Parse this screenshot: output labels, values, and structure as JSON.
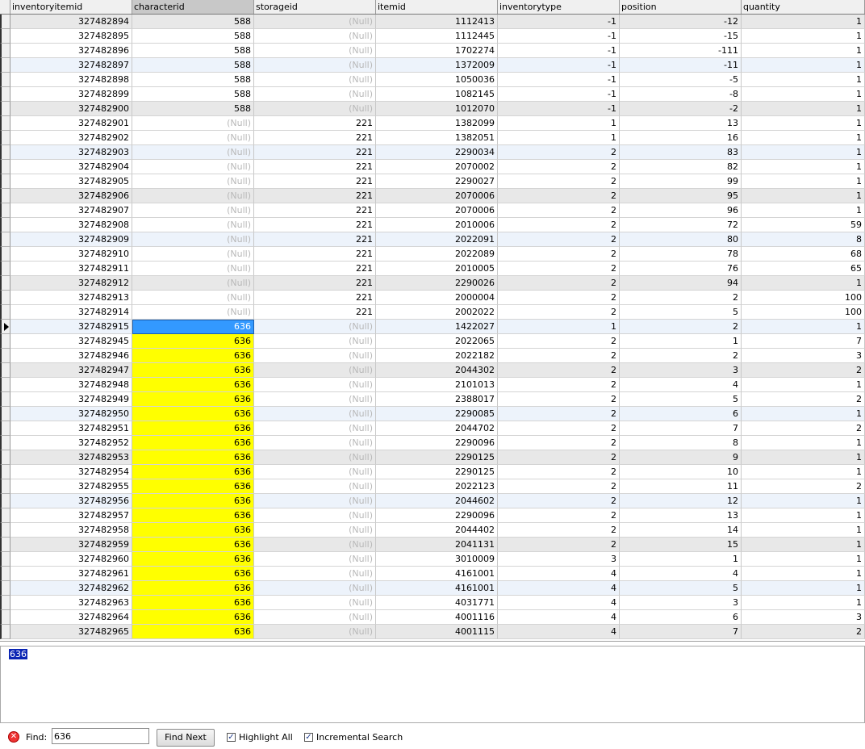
{
  "columns": [
    "inventoryitemid",
    "characterid",
    "storageid",
    "itemid",
    "inventorytype",
    "position",
    "quantity"
  ],
  "selected_column_index": 1,
  "null_text": "(Null)",
  "rows": [
    [
      "327482894",
      "588",
      null,
      "1112413",
      "-1",
      "-12",
      "1"
    ],
    [
      "327482895",
      "588",
      null,
      "1112445",
      "-1",
      "-15",
      "1"
    ],
    [
      "327482896",
      "588",
      null,
      "1702274",
      "-1",
      "-111",
      "1"
    ],
    [
      "327482897",
      "588",
      null,
      "1372009",
      "-1",
      "-11",
      "1"
    ],
    [
      "327482898",
      "588",
      null,
      "1050036",
      "-1",
      "-5",
      "1"
    ],
    [
      "327482899",
      "588",
      null,
      "1082145",
      "-1",
      "-8",
      "1"
    ],
    [
      "327482900",
      "588",
      null,
      "1012070",
      "-1",
      "-2",
      "1"
    ],
    [
      "327482901",
      null,
      "221",
      "1382099",
      "1",
      "13",
      "1"
    ],
    [
      "327482902",
      null,
      "221",
      "1382051",
      "1",
      "16",
      "1"
    ],
    [
      "327482903",
      null,
      "221",
      "2290034",
      "2",
      "83",
      "1"
    ],
    [
      "327482904",
      null,
      "221",
      "2070002",
      "2",
      "82",
      "1"
    ],
    [
      "327482905",
      null,
      "221",
      "2290027",
      "2",
      "99",
      "1"
    ],
    [
      "327482906",
      null,
      "221",
      "2070006",
      "2",
      "95",
      "1"
    ],
    [
      "327482907",
      null,
      "221",
      "2070006",
      "2",
      "96",
      "1"
    ],
    [
      "327482908",
      null,
      "221",
      "2010006",
      "2",
      "72",
      "59"
    ],
    [
      "327482909",
      null,
      "221",
      "2022091",
      "2",
      "80",
      "8"
    ],
    [
      "327482910",
      null,
      "221",
      "2022089",
      "2",
      "78",
      "68"
    ],
    [
      "327482911",
      null,
      "221",
      "2010005",
      "2",
      "76",
      "65"
    ],
    [
      "327482912",
      null,
      "221",
      "2290026",
      "2",
      "94",
      "1"
    ],
    [
      "327482913",
      null,
      "221",
      "2000004",
      "2",
      "2",
      "100"
    ],
    [
      "327482914",
      null,
      "221",
      "2002022",
      "2",
      "5",
      "100"
    ],
    [
      "327482915",
      "636",
      null,
      "1422027",
      "1",
      "2",
      "1"
    ],
    [
      "327482945",
      "636",
      null,
      "2022065",
      "2",
      "1",
      "7"
    ],
    [
      "327482946",
      "636",
      null,
      "2022182",
      "2",
      "2",
      "3"
    ],
    [
      "327482947",
      "636",
      null,
      "2044302",
      "2",
      "3",
      "2"
    ],
    [
      "327482948",
      "636",
      null,
      "2101013",
      "2",
      "4",
      "1"
    ],
    [
      "327482949",
      "636",
      null,
      "2388017",
      "2",
      "5",
      "2"
    ],
    [
      "327482950",
      "636",
      null,
      "2290085",
      "2",
      "6",
      "1"
    ],
    [
      "327482951",
      "636",
      null,
      "2044702",
      "2",
      "7",
      "2"
    ],
    [
      "327482952",
      "636",
      null,
      "2290096",
      "2",
      "8",
      "1"
    ],
    [
      "327482953",
      "636",
      null,
      "2290125",
      "2",
      "9",
      "1"
    ],
    [
      "327482954",
      "636",
      null,
      "2290125",
      "2",
      "10",
      "1"
    ],
    [
      "327482955",
      "636",
      null,
      "2022123",
      "2",
      "11",
      "2"
    ],
    [
      "327482956",
      "636",
      null,
      "2044602",
      "2",
      "12",
      "1"
    ],
    [
      "327482957",
      "636",
      null,
      "2290096",
      "2",
      "13",
      "1"
    ],
    [
      "327482958",
      "636",
      null,
      "2044402",
      "2",
      "14",
      "1"
    ],
    [
      "327482959",
      "636",
      null,
      "2041131",
      "2",
      "15",
      "1"
    ],
    [
      "327482960",
      "636",
      null,
      "3010009",
      "3",
      "1",
      "1"
    ],
    [
      "327482961",
      "636",
      null,
      "4161001",
      "4",
      "4",
      "1"
    ],
    [
      "327482962",
      "636",
      null,
      "4161001",
      "4",
      "5",
      "1"
    ],
    [
      "327482963",
      "636",
      null,
      "4031771",
      "4",
      "3",
      "1"
    ],
    [
      "327482964",
      "636",
      null,
      "4001116",
      "4",
      "6",
      "3"
    ],
    [
      "327482965",
      "636",
      null,
      "4001115",
      "4",
      "7",
      "2"
    ]
  ],
  "current_row_index": 21,
  "highlight_value": "636",
  "memo": {
    "text": "636"
  },
  "findbar": {
    "close_icon": "close-icon",
    "label": "Find:",
    "value": "636",
    "next_label": "Find Next",
    "highlight_all_label": "Highlight All",
    "highlight_all_checked": true,
    "incremental_label": "Incremental Search",
    "incremental_checked": true
  },
  "colors": {
    "row_shade": "#e8e8e8",
    "row_blue": "#edf3fb",
    "highlight": "#ffff00",
    "selection": "#3399ff"
  }
}
